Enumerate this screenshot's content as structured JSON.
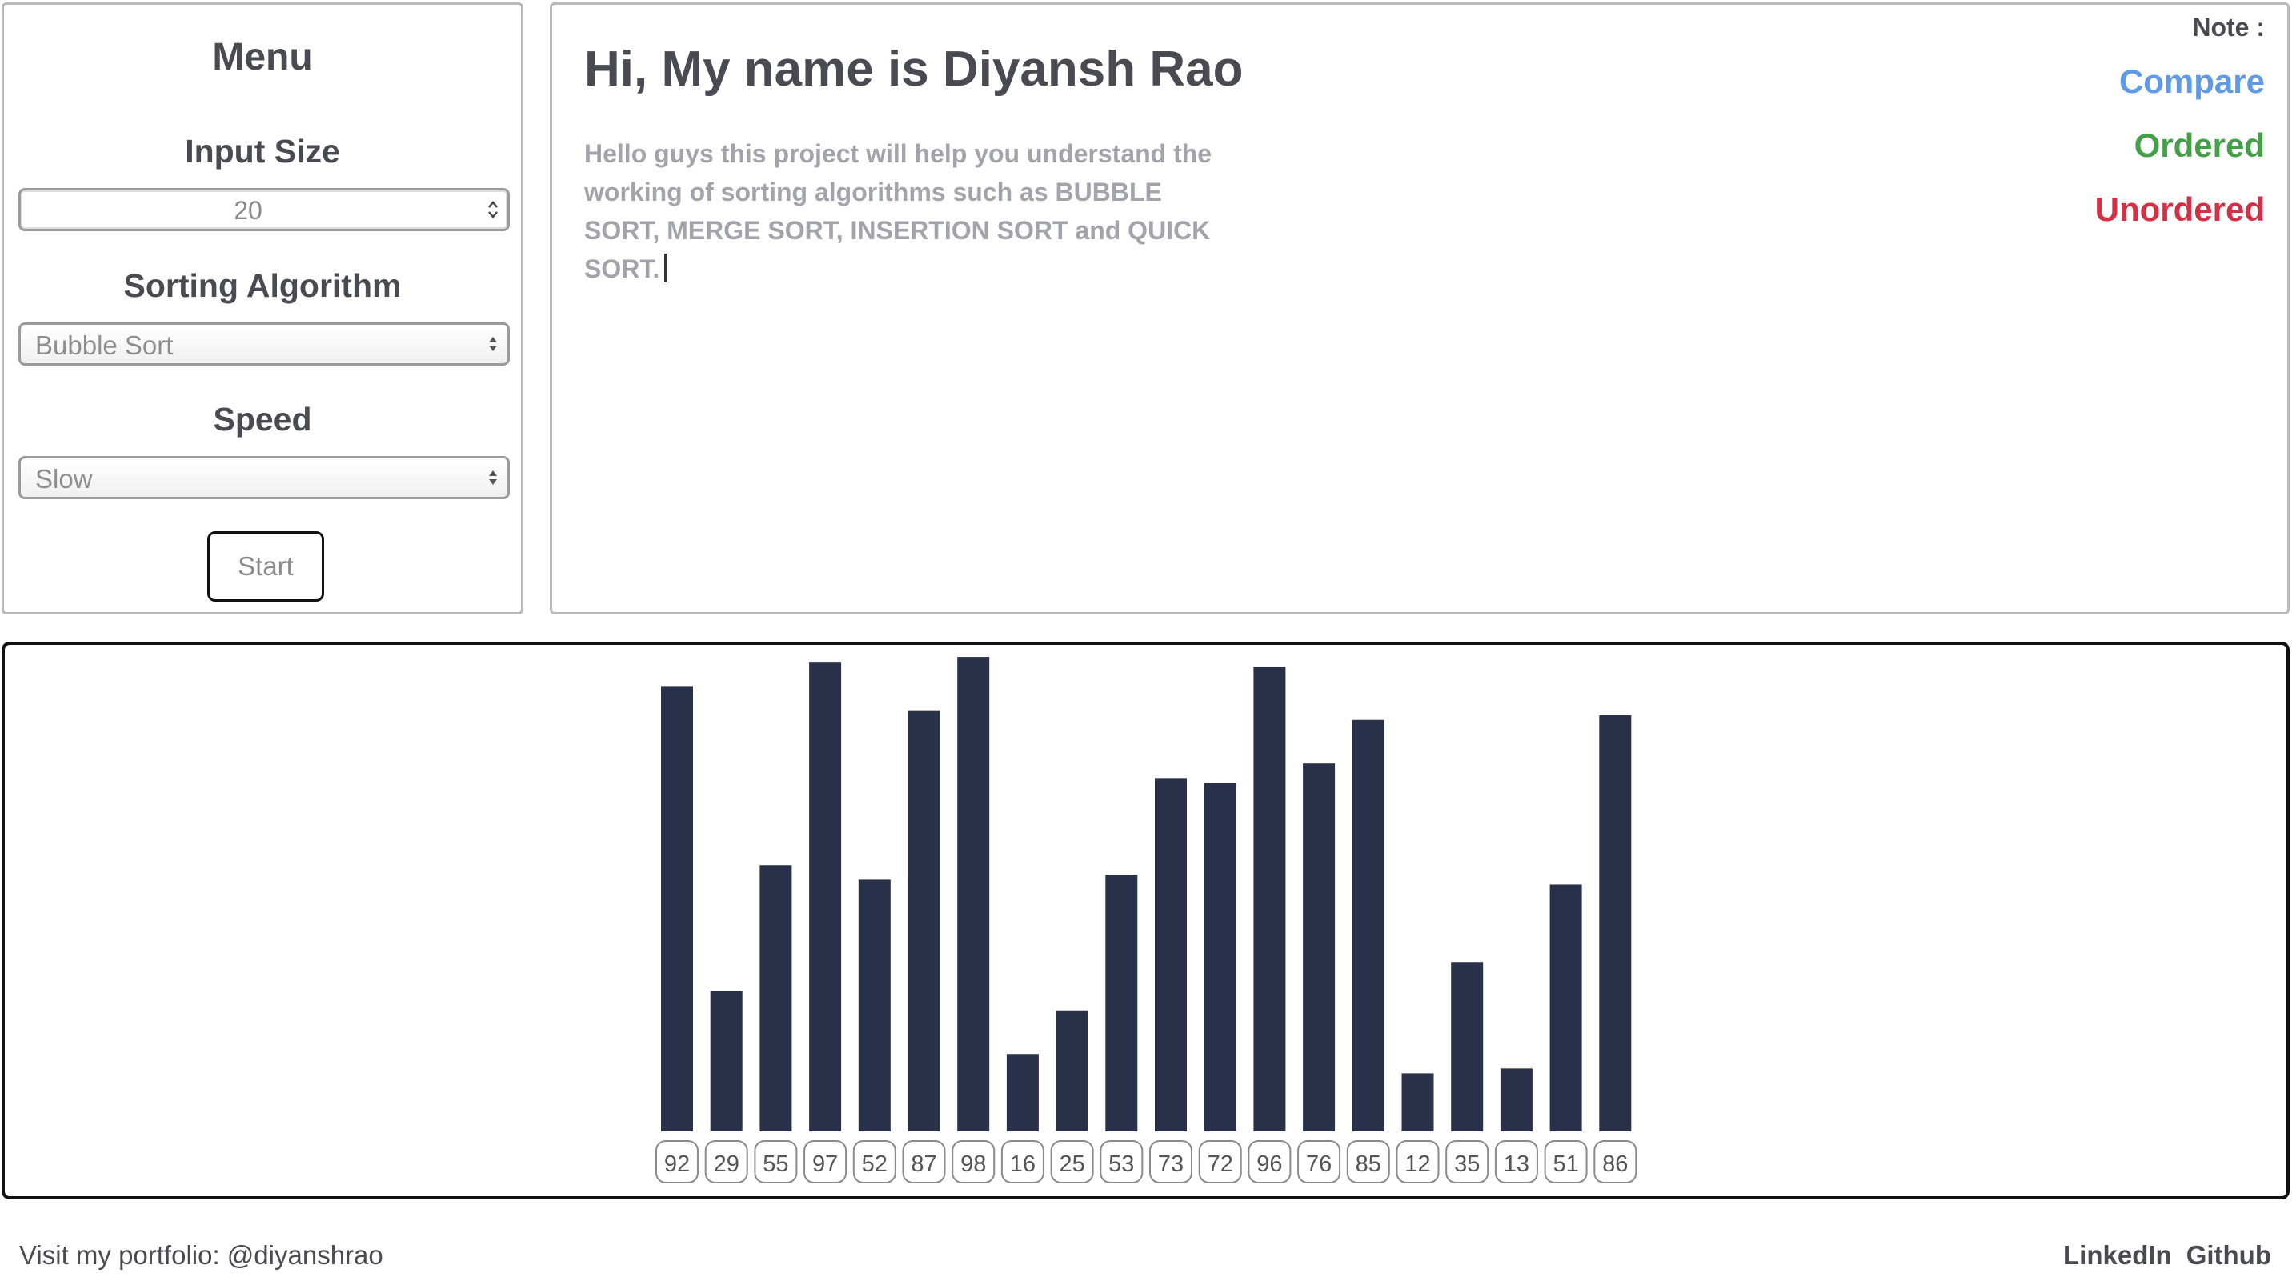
{
  "menu": {
    "title": "Menu",
    "input_size_label": "Input Size",
    "input_size_value": "20",
    "algorithm_label": "Sorting Algorithm",
    "algorithm_selected": "Bubble Sort",
    "speed_label": "Speed",
    "speed_selected": "Slow",
    "start_label": "Start"
  },
  "intro": {
    "title": "Hi, My name is Diyansh Rao",
    "description": "Hello guys this project will help you understand the working of sorting algorithms such as BUBBLE SORT, MERGE SORT, INSERTION SORT and QUICK SORT."
  },
  "legend": {
    "note_label": "Note :",
    "items": [
      {
        "label": "Compare",
        "color": "#5f9ae6"
      },
      {
        "label": "Ordered",
        "color": "#43a047"
      },
      {
        "label": "Unordered",
        "color": "#d32f45"
      }
    ]
  },
  "chart_data": {
    "type": "bar",
    "bar_color": "#283149",
    "values": [
      92,
      29,
      55,
      97,
      52,
      87,
      98,
      16,
      25,
      53,
      73,
      72,
      96,
      76,
      85,
      12,
      35,
      13,
      51,
      86
    ],
    "ylim": [
      0,
      100
    ]
  },
  "footer": {
    "portfolio_text": "Visit my portfolio: @diyanshrao",
    "links": [
      "LinkedIn",
      "Github"
    ]
  }
}
